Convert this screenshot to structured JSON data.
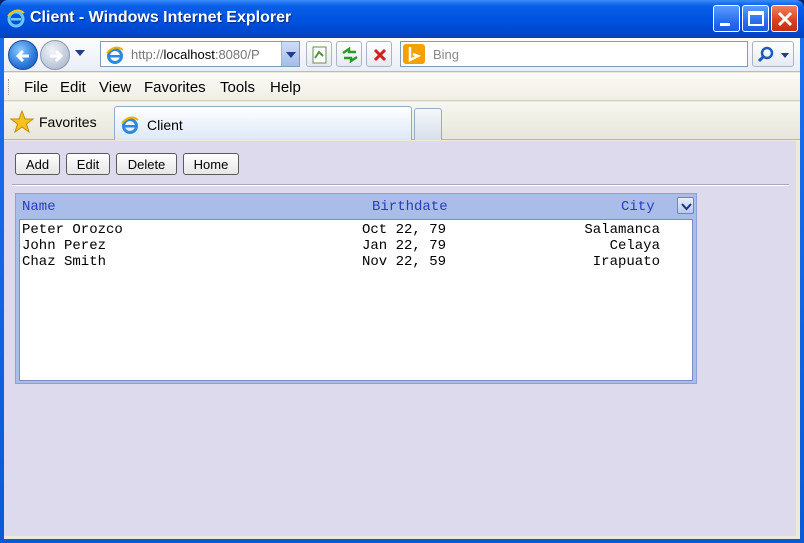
{
  "window": {
    "title": "Client - Windows Internet Explorer"
  },
  "addressbar": {
    "url_prefix": "http://",
    "url_host": "localhost",
    "url_suffix": ":8080/P",
    "search_placeholder": "Bing"
  },
  "menu": {
    "items": [
      "File",
      "Edit",
      "View",
      "Favorites",
      "Tools",
      "Help"
    ]
  },
  "favorites": {
    "label": "Favorites"
  },
  "tab": {
    "label": "Client"
  },
  "toolbar": {
    "add_label": "Add",
    "edit_label": "Edit",
    "delete_label": "Delete",
    "home_label": "Home"
  },
  "grid": {
    "columns": [
      "Name",
      "Birthdate",
      "City"
    ],
    "rows": [
      {
        "name": "Peter Orozco",
        "birthdate": "Oct 22, 79",
        "city": "Salamanca"
      },
      {
        "name": "John Perez",
        "birthdate": "Jan 22, 79",
        "city": "Celaya"
      },
      {
        "name": "Chaz Smith",
        "birthdate": "Nov 22, 59",
        "city": "Irapuato"
      }
    ]
  },
  "colors": {
    "page_background": "#dcdaec",
    "grid_header": "#a9bde8",
    "header_text": "#2a3cb8",
    "titlebar": "#0053e0"
  }
}
